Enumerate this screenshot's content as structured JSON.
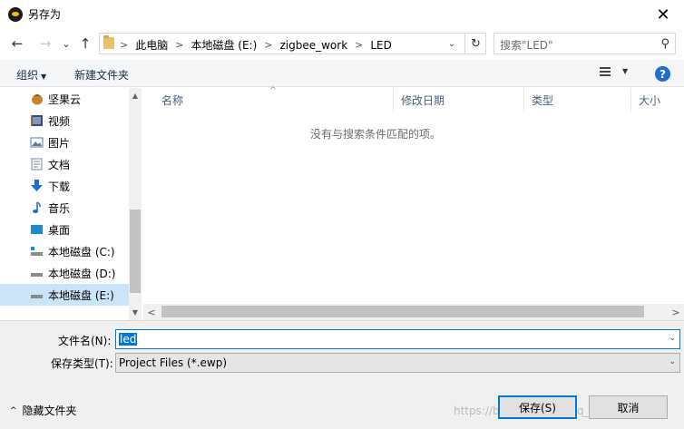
{
  "window": {
    "title": "另存为",
    "close_glyph": "✕"
  },
  "nav": {
    "back_glyph": "←",
    "forward_glyph": "→",
    "recent_glyph": "⌄",
    "up_glyph": "↑",
    "breadcrumbs": [
      "此电脑",
      "本地磁盘 (E:)",
      "zigbee_work",
      "LED"
    ],
    "crumb_sep": ">",
    "address_dropdown_glyph": "⌄",
    "refresh_glyph": "↻",
    "search_placeholder": "搜索\"LED\"",
    "search_glyph": "⚲"
  },
  "commands": {
    "organize": "组织",
    "organize_caret": "▼",
    "new_folder": "新建文件夹",
    "view_dropdown": "▼",
    "help": "?"
  },
  "sidebar": {
    "items": [
      {
        "label": "坚果云",
        "icon": "nutstore-icon",
        "color": "#c8822e"
      },
      {
        "label": "视频",
        "icon": "video-icon",
        "color": "#3a4b63"
      },
      {
        "label": "图片",
        "icon": "picture-icon",
        "color": "#5a7aa0"
      },
      {
        "label": "文档",
        "icon": "document-icon",
        "color": "#7a8aa0"
      },
      {
        "label": "下载",
        "icon": "download-icon",
        "color": "#1e6fd0"
      },
      {
        "label": "音乐",
        "icon": "music-icon",
        "color": "#1e6fd0"
      },
      {
        "label": "桌面",
        "icon": "desktop-icon",
        "color": "#1e8ad0"
      },
      {
        "label": "本地磁盘 (C:)",
        "icon": "drive-c-icon",
        "color": "#6a6a6a"
      },
      {
        "label": "本地磁盘 (D:)",
        "icon": "drive-d-icon",
        "color": "#6a6a6a"
      },
      {
        "label": "本地磁盘 (E:)",
        "icon": "drive-e-icon",
        "color": "#6a6a6a",
        "selected": true
      }
    ],
    "scroll_up": "▲",
    "scroll_down": "▼"
  },
  "filelist": {
    "columns": [
      "名称",
      "修改日期",
      "类型",
      "大小"
    ],
    "sort_caret": "^",
    "empty_message": "没有与搜索条件匹配的项。",
    "hscroll_left": "<",
    "hscroll_right": ">"
  },
  "form": {
    "filename_label": "文件名(N):",
    "filename_value": "led",
    "filetype_label": "保存类型(T):",
    "filetype_value": "Project Files (*.ewp)",
    "dropdown_glyph": "⌄"
  },
  "footer": {
    "hide_folders_chev": "^",
    "hide_folders": "隐藏文件夹",
    "save": "保存(S)",
    "cancel": "取消",
    "watermark": "https://blog.csdn.net/qq_42398342"
  },
  "colors": {
    "accent": "#0078d7",
    "selected": "#cce4f7"
  }
}
